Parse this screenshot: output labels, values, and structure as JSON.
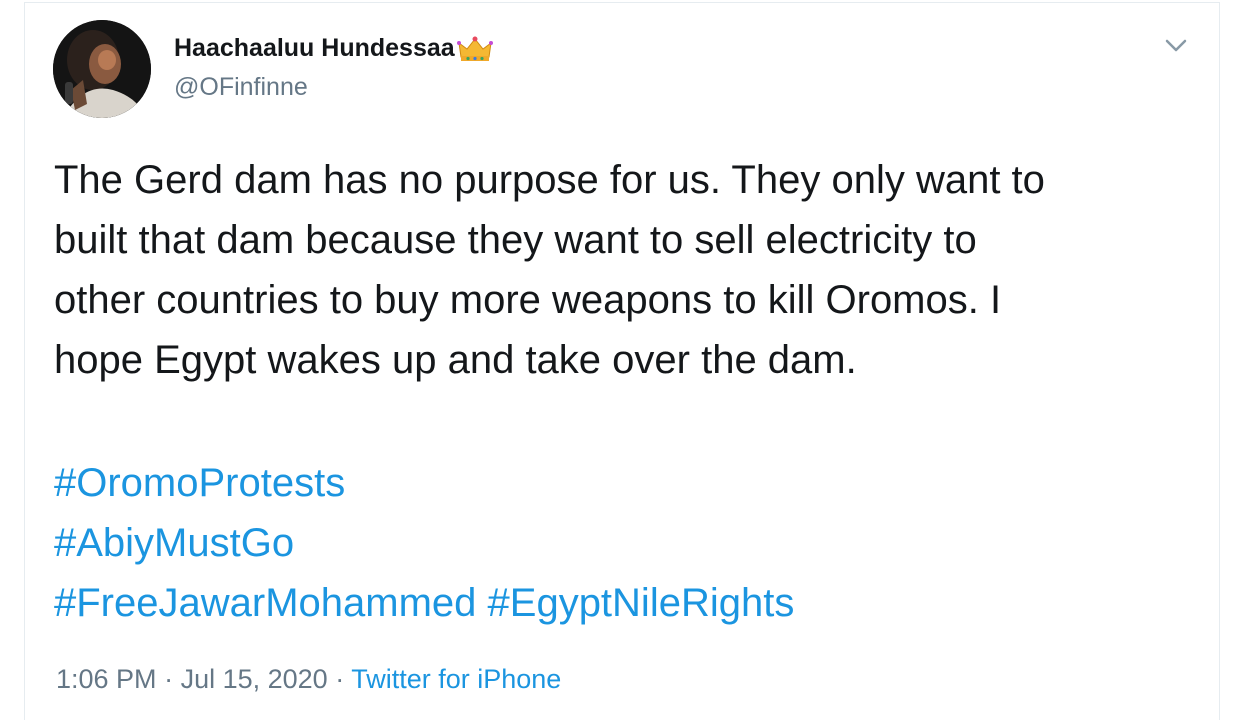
{
  "user": {
    "display_name": "Haachaaluu Hundessaa",
    "handle": "@OFinfinne",
    "emoji": "crown-icon"
  },
  "tweet": {
    "lines": [
      "The Gerd dam has no purpose for us. They only want to",
      "built that dam because they want to sell electricity to",
      "other countries to buy more weapons to kill Oromos. I",
      "hope Egypt wakes up and take over the dam."
    ],
    "hashtags": {
      "h1": "#OromoProtests",
      "h2": "#AbiyMustGo",
      "h3": "#FreeJawarMohammed",
      "h4": "#EgyptNileRights"
    }
  },
  "meta": {
    "time": "1:06 PM",
    "separator": " · ",
    "date": "Jul 15, 2020",
    "source": "Twitter for iPhone"
  },
  "colors": {
    "link": "#1b95e0",
    "secondary": "#657786",
    "text": "#14171a",
    "border": "#e6ecf0"
  }
}
